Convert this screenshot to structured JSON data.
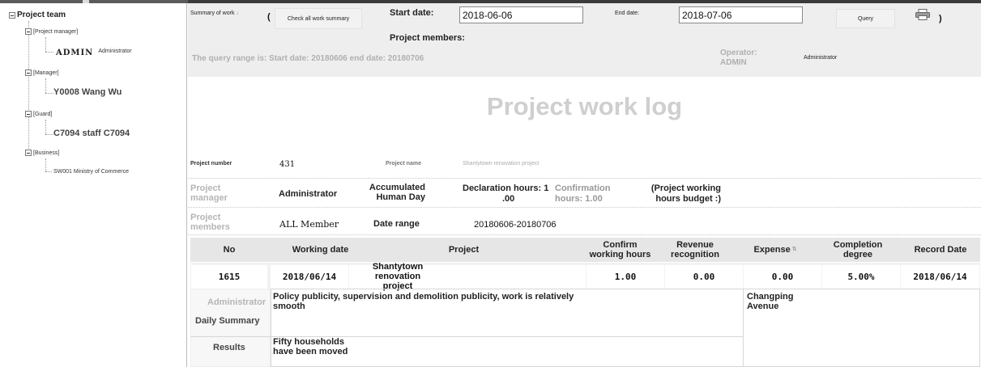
{
  "sidebar": {
    "root": "Project team",
    "groups": [
      {
        "label": "[Project manager]",
        "code": "ADMIN",
        "name": "Administrator"
      },
      {
        "label": "[Manager]",
        "member": "Y0008 Wang Wu"
      },
      {
        "label": "[Guard]",
        "member": "C7094 staff C7094"
      },
      {
        "label": "[Business]",
        "member": "SW001 Ministry of Commerce"
      }
    ]
  },
  "toolbar": {
    "summary_label": "Summary of work",
    "check_all_button": "Check all work summary",
    "start_date_label": "Start date:",
    "start_date_value": "2018-06-06",
    "end_date_label": "End date:",
    "end_date_value": "2018-07-06",
    "query_button": "Query",
    "project_members_label": "Project members:",
    "query_range_text": "The query range is: Start date: 20180606 end date: 20180706",
    "operator_label": "Operator:",
    "operator_code": "ADMIN",
    "operator_name": "Administrator",
    "open_paren": "(",
    "close_paren": ")"
  },
  "report": {
    "title": "Project work log",
    "project_number_label": "Project number",
    "project_number_value": "431",
    "project_name_label": "Project name",
    "project_name_value": "Shantytown renovation project",
    "project_manager_label": "Project manager",
    "project_manager_value": "Administrator",
    "accumulated_label": "Accumulated Human Day",
    "declaration_hours_label": "Declaration hours: 1",
    "declaration_hours_cont": ".00",
    "confirmation_hours_label": "Confirmation",
    "confirmation_hours_value": "hours: 1.00",
    "budget_label": "(Project working",
    "budget_label_cont": "hours budget :)",
    "project_members_label": "Project members",
    "project_members_value": "ALL Member",
    "date_range_label": "Date range",
    "date_range_value": "20180606-20180706"
  },
  "table": {
    "headers": [
      "No",
      "Working date",
      "Project",
      "Confirm working hours",
      "Revenue recognition",
      "Expense",
      "Completion degree",
      "Record Date"
    ],
    "row": {
      "no": "1615",
      "working_date": "2018/06/14",
      "project": "Shantytown renovation project",
      "confirm_hours": "1.00",
      "revenue": "0.00",
      "expense": "0.00",
      "completion": "5.00%",
      "record_date": "2018/06/14"
    },
    "detail": {
      "user": "Administrator",
      "daily_summary_label": "Daily Summary",
      "daily_summary_text": "Policy publicity, supervision and demolition publicity, work is relatively smooth",
      "location": "Changping Avenue",
      "results_label": "Results",
      "results_text": "Fifty households have been moved"
    }
  }
}
